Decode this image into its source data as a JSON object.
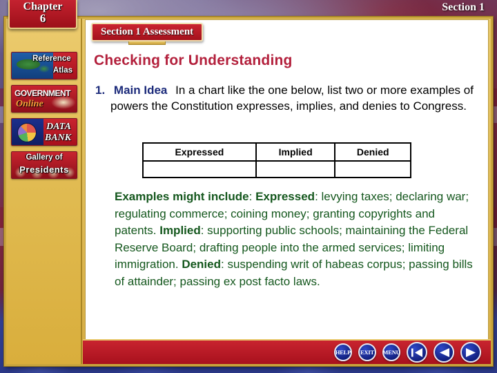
{
  "background": {
    "description": "american-flag-photo",
    "colors": {
      "blue": "#313f92",
      "red": "#8e1f33",
      "white": "#c9c5d4",
      "gold_frame": "#d6ad44"
    }
  },
  "chapter_tag": {
    "line1": "Chapter",
    "line2": "6"
  },
  "section_tag": {
    "label": "Section 1"
  },
  "sidebar": {
    "items": [
      {
        "id": "reference-atlas",
        "line1": "Reference",
        "line2": "Atlas",
        "icon": "world-map-icon"
      },
      {
        "id": "government-online",
        "line1": "GOVERNMENT",
        "line2": "Online",
        "icon": "open-book-icon"
      },
      {
        "id": "data-bank",
        "line1": "DATA",
        "line2": "BANK",
        "icon": "pie-chart-icon"
      },
      {
        "id": "gallery-of-presidents",
        "line1": "Gallery of",
        "line2": "Presidents",
        "icon": "presidents-portraits-icon"
      }
    ]
  },
  "content": {
    "banner": "Section 1 Assessment",
    "heading": "Checking for Understanding",
    "question": {
      "number": "1.",
      "label": "Main Idea",
      "text": "In a chart like the one below, list two or more examples of powers the Constitution expresses, implies, and denies to Congress."
    },
    "table": {
      "headers": [
        "Expressed",
        "Implied",
        "Denied"
      ],
      "rows": [
        [
          "",
          "",
          ""
        ]
      ]
    },
    "answer": {
      "intro_bold": "Examples might include",
      "segments": [
        {
          "bold": "Examples might include",
          "text": ": "
        },
        {
          "bold": "Expressed",
          "text": ": levying taxes; declaring war; regulating commerce; coining money; granting copyrights and patents. "
        },
        {
          "bold": "Implied",
          "text": ": supporting public schools; maintaining the Federal Reserve Board; drafting people into the armed services; limiting immigration. "
        },
        {
          "bold": "Denied",
          "text": ": suspending writ of habeas corpus; passing bills of attainder; passing ex post facto laws."
        }
      ],
      "plain": "Examples might include: Expressed: levying taxes; declaring war; regulating commerce; coining money; granting copyrights and patents. Implied: supporting public schools; maintaining the Federal Reserve Board; drafting people into the armed services; limiting immigration. Denied: suspending writ of habeas corpus; passing bills of attainder; passing ex post facto laws."
    }
  },
  "navbar": {
    "buttons": [
      {
        "id": "help",
        "label": "HELP"
      },
      {
        "id": "exit",
        "label": "EXIT"
      },
      {
        "id": "menu",
        "label": "MENU"
      }
    ],
    "arrows": [
      {
        "id": "first-slide",
        "icon": "arrow-to-start-icon"
      },
      {
        "id": "previous-slide",
        "icon": "arrow-left-icon"
      },
      {
        "id": "next-slide",
        "icon": "arrow-right-icon"
      }
    ]
  },
  "colors": {
    "heading_red": "#b3203c",
    "question_blue": "#1b2a7a",
    "answer_green": "#14571d",
    "banner_red": "#b81a26",
    "gold": "#e2bd55",
    "nav_blue": "#12207f"
  }
}
